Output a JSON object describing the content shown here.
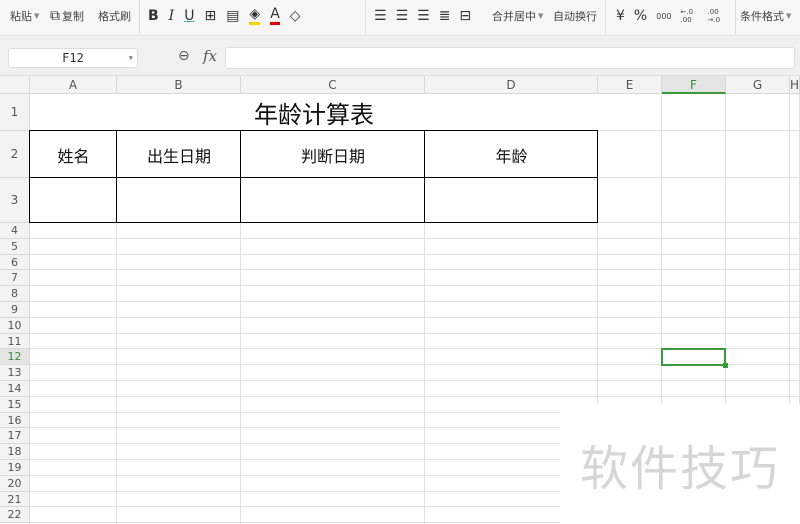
{
  "toolbar": {
    "paste": "粘贴",
    "copy": "复制",
    "format_painter": "格式刷",
    "merge_center": "合并居中",
    "wrap_text": "自动换行",
    "currency": "¥",
    "percent": "%",
    "thousands": "000",
    "inc_decimal": "←.0 .00",
    "dec_decimal": ".00 →.0",
    "conditional_format": "条件格式"
  },
  "formula_bar": {
    "name_box": "F12",
    "fx": "fx",
    "value": ""
  },
  "columns": [
    "A",
    "B",
    "C",
    "D",
    "E",
    "F",
    "G",
    "H"
  ],
  "rows": [
    "1",
    "2",
    "3",
    "4",
    "5",
    "6",
    "7",
    "8",
    "9",
    "10",
    "11",
    "12",
    "13",
    "14",
    "15",
    "16",
    "17",
    "18",
    "19",
    "20",
    "21",
    "22"
  ],
  "selected": {
    "col": "F",
    "row": "12"
  },
  "sheet": {
    "title": "年龄计算表",
    "headers": [
      "姓名",
      "出生日期",
      "判断日期",
      "年龄"
    ]
  },
  "watermark": "软件技巧",
  "colors": {
    "accent": "#3a9a3a"
  }
}
